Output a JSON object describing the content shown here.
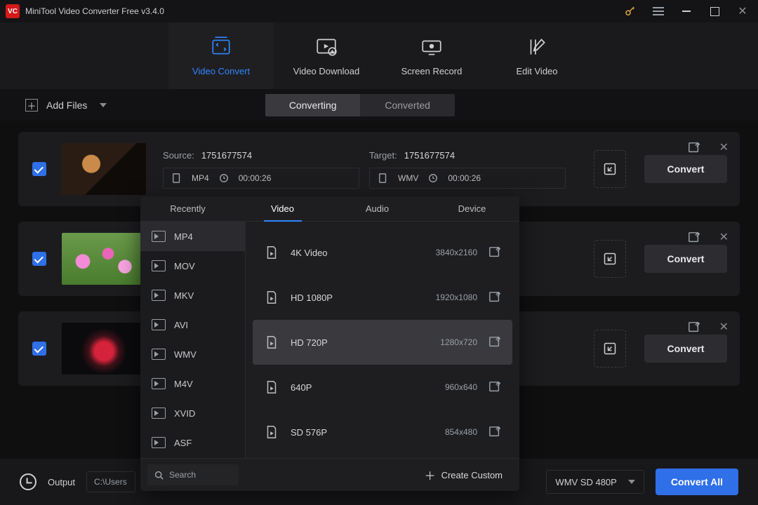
{
  "colors": {
    "accent": "#2f87ff",
    "primary_btn": "#2f6fe8"
  },
  "titlebar": {
    "title": "MiniTool Video Converter Free v3.4.0",
    "logo_text": "VC"
  },
  "toptabs": {
    "items": [
      {
        "label": "Video Convert",
        "icon": "convert-icon",
        "active": true
      },
      {
        "label": "Video Download",
        "icon": "download-icon"
      },
      {
        "label": "Screen Record",
        "icon": "record-icon"
      },
      {
        "label": "Edit Video",
        "icon": "edit-video-icon"
      }
    ]
  },
  "toolbar": {
    "add_files": "Add Files",
    "seg": {
      "a": "Converting",
      "b": "Converted",
      "active": "a"
    }
  },
  "items": [
    {
      "source_label": "Source:",
      "source_name": "1751677574",
      "target_label": "Target:",
      "target_name": "1751677574",
      "source_fmt": "MP4",
      "target_fmt": "WMV",
      "source_dur": "00:00:26",
      "target_dur": "00:00:26",
      "convert": "Convert"
    },
    {
      "convert": "Convert"
    },
    {
      "convert": "Convert"
    }
  ],
  "bottombar": {
    "output_label": "Output",
    "output_path": "C:\\Users",
    "format_selected": "WMV SD 480P",
    "convert_all": "Convert All"
  },
  "popover": {
    "tabs": [
      "Recently",
      "Video",
      "Audio",
      "Device"
    ],
    "active_tab": 1,
    "formats": [
      "MP4",
      "MOV",
      "MKV",
      "AVI",
      "WMV",
      "M4V",
      "XVID",
      "ASF"
    ],
    "active_format": 0,
    "presets": [
      {
        "name": "4K Video",
        "res": "3840x2160"
      },
      {
        "name": "HD 1080P",
        "res": "1920x1080"
      },
      {
        "name": "HD 720P",
        "res": "1280x720",
        "selected": true
      },
      {
        "name": "640P",
        "res": "960x640"
      },
      {
        "name": "SD 576P",
        "res": "854x480"
      }
    ],
    "search_placeholder": "Search",
    "create_custom": "Create Custom"
  }
}
